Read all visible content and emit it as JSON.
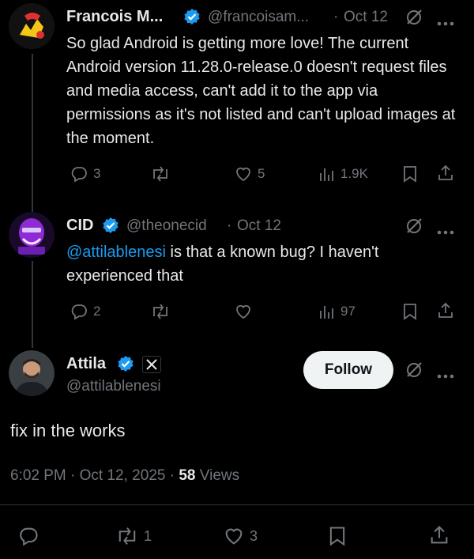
{
  "tweet1": {
    "name": "Francois M...",
    "handle": "@francoisam...",
    "separator": "·",
    "date": "Oct 12",
    "text": "So glad Android is getting more love! The current Android version 11.28.0-release.0 doesn't request files and media access, can't add it to the app via permissions as it's not listed and can't upload images at the moment.",
    "replies": "3",
    "likes": "5",
    "views": "1.9K"
  },
  "tweet2": {
    "name": "CID",
    "handle": "@theonecid",
    "separator": "·",
    "date": "Oct 12",
    "mention": "@attilablenesi",
    "text": " is that a known bug? I haven't experienced that",
    "replies": "2",
    "views": "97"
  },
  "main": {
    "name": "Attila",
    "handle": "@attilablenesi",
    "follow_label": "Follow",
    "text": "fix in the works",
    "time": "6:02 PM",
    "separator": "·",
    "date": "Oct 12, 2025",
    "views_count": "58",
    "views_label": "Views",
    "retweets": "1",
    "likes": "3"
  },
  "colors": {
    "accent": "#1d9bf0",
    "muted": "#71767b",
    "text": "#e7e9ea",
    "background": "#000000"
  },
  "icons": [
    "reply-icon",
    "retweet-icon",
    "like-icon",
    "views-icon",
    "bookmark-icon",
    "share-icon",
    "grok-icon",
    "more-icon",
    "verified-icon",
    "affiliate-x-icon"
  ]
}
